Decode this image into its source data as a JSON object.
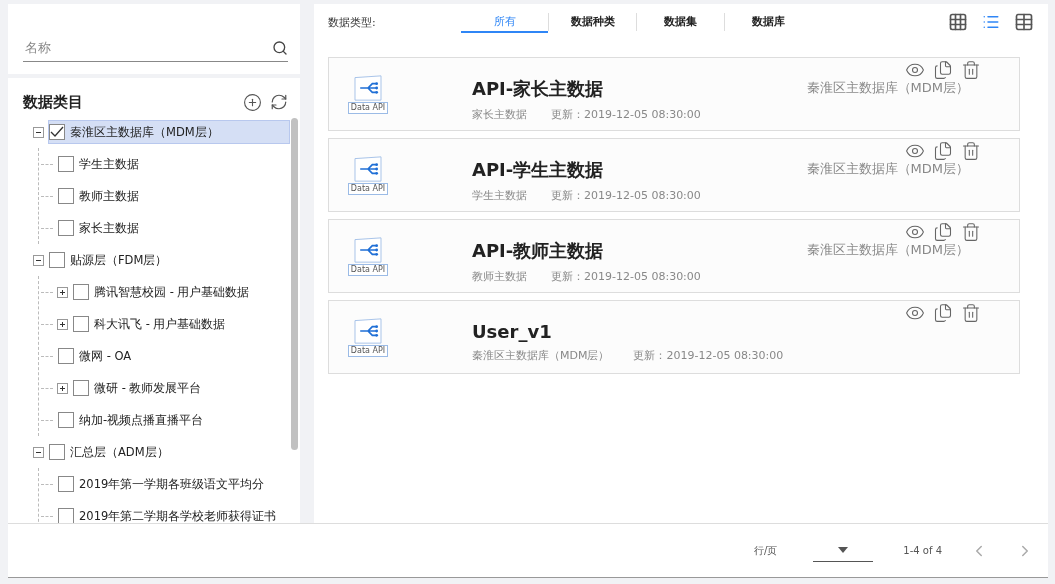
{
  "search": {
    "placeholder": "名称"
  },
  "category": {
    "title": "数据类目"
  },
  "tree": [
    {
      "label": "秦淮区主数据库（MDM层）",
      "expanded": true,
      "checked": true,
      "selected": true,
      "children": [
        {
          "label": "学生主数据",
          "checked": false,
          "selected": false
        },
        {
          "label": "教师主数据",
          "checked": false,
          "selected": false
        },
        {
          "label": "家长主数据",
          "checked": false,
          "selected": false
        }
      ]
    },
    {
      "label": "贴源层（FDM层）",
      "expanded": true,
      "checked": false,
      "selected": false,
      "children": [
        {
          "label": "腾讯智慧校园 - 用户基础数据",
          "expanded": false,
          "checked": false,
          "selected": false
        },
        {
          "label": "科大讯飞 - 用户基础数据",
          "expanded": false,
          "checked": false,
          "selected": false
        },
        {
          "label": "微网 - OA",
          "checked": false,
          "selected": false
        },
        {
          "label": "微研 - 教师发展平台",
          "expanded": false,
          "checked": false,
          "selected": false
        },
        {
          "label": "纳加-视频点播直播平台",
          "checked": false,
          "selected": false
        }
      ]
    },
    {
      "label": "汇总层（ADM层）",
      "expanded": true,
      "checked": false,
      "selected": false,
      "children": [
        {
          "label": "2019年第一学期各班级语文平均分",
          "checked": false,
          "selected": false
        },
        {
          "label": "2019年第二学期各学校老师获得证书",
          "checked": false,
          "selected": false
        }
      ]
    }
  ],
  "filter": {
    "label": "数据类型:",
    "tabs": [
      {
        "label": "所有",
        "selected": true
      },
      {
        "label": "数据种类",
        "selected": false
      },
      {
        "label": "数据集",
        "selected": false
      },
      {
        "label": "数据库",
        "selected": false
      }
    ]
  },
  "views": [
    {
      "kind": "grid",
      "selected": false
    },
    {
      "kind": "list",
      "selected": true
    },
    {
      "kind": "table",
      "selected": false
    }
  ],
  "cards": [
    {
      "icon_label": "Data API",
      "title": "API-家长主数据",
      "meta": "家长主数据",
      "updated": "更新：2019-12-05 08:30:00",
      "source": "秦淮区主数据库（MDM层）"
    },
    {
      "icon_label": "Data API",
      "title": "API-学生主数据",
      "meta": "学生主数据",
      "updated": "更新：2019-12-05 08:30:00",
      "source": "秦淮区主数据库（MDM层）"
    },
    {
      "icon_label": "Data API",
      "title": "API-教师主数据",
      "meta": "教师主数据",
      "updated": "更新：2019-12-05 08:30:00",
      "source": "秦淮区主数据库（MDM层）"
    },
    {
      "icon_label": "Data API",
      "title": "User_v1",
      "meta": "秦淮区主数据库（MDM层）",
      "updated": "更新：2019-12-05 08:30:00"
    }
  ],
  "pagination": {
    "rows_label": "行/页",
    "range": "1-4 of 4"
  }
}
